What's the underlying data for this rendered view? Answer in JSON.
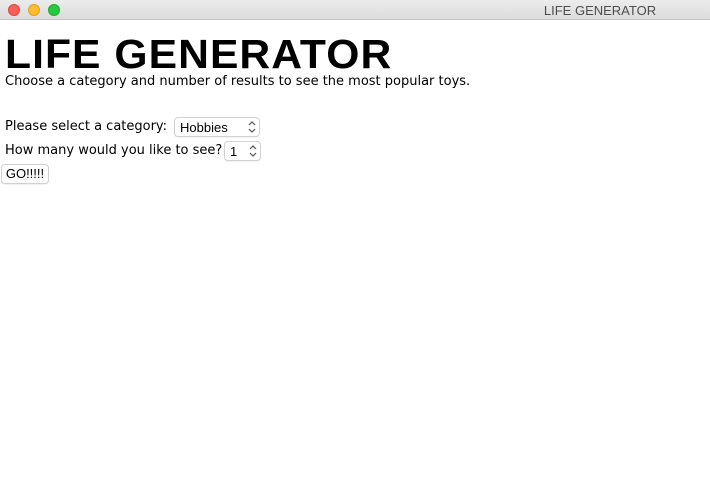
{
  "window": {
    "title": "LIFE GENERATOR"
  },
  "main": {
    "heading": "LIFE GENERATOR",
    "subtitle": "Choose a category and number of results to see the most popular toys."
  },
  "form": {
    "category_label": "Please select a category:",
    "category_value": "Hobbies",
    "count_label": "How many would you like to see?",
    "count_value": "1",
    "go_label": "GO!!!!!"
  },
  "colors": {
    "close": "#fe5f57",
    "minimize": "#febc2e",
    "maximize": "#28c840"
  }
}
